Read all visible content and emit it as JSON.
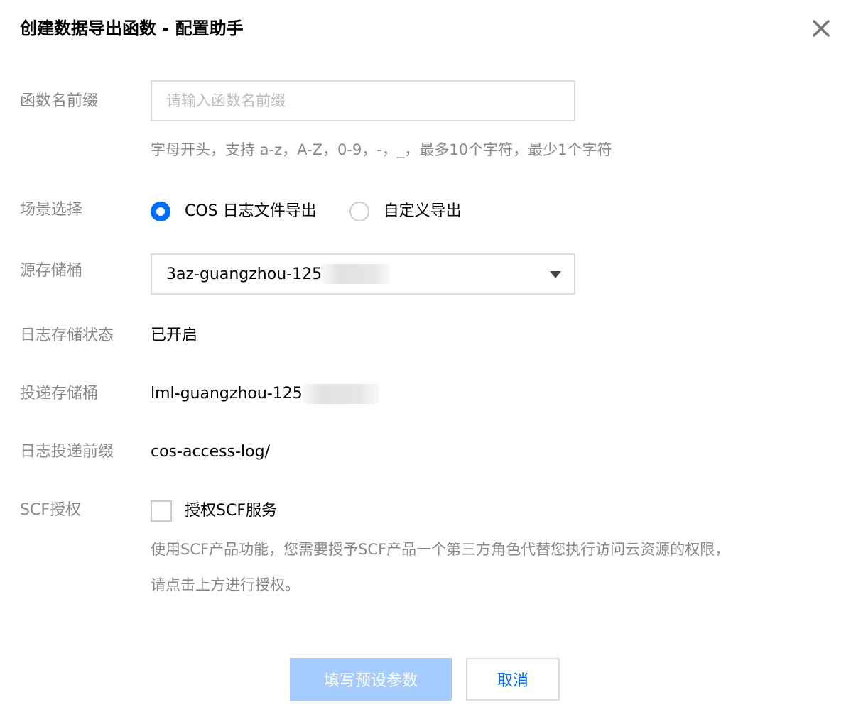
{
  "dialog": {
    "title": "创建数据导出函数 - 配置助手",
    "close_icon": "close-icon"
  },
  "form": {
    "prefix": {
      "label": "函数名前缀",
      "value": "",
      "placeholder": "请输入函数名前缀",
      "hint": "字母开头，支持 a-z，A-Z，0-9，-，_，最多10个字符，最少1个字符"
    },
    "scene": {
      "label": "场景选择",
      "options": [
        {
          "label": "COS 日志文件导出",
          "checked": true
        },
        {
          "label": "自定义导出",
          "checked": false
        }
      ]
    },
    "source_bucket": {
      "label": "源存储桶",
      "selected": "3az-guangzhou-125"
    },
    "log_storage_status": {
      "label": "日志存储状态",
      "value": "已开启"
    },
    "delivery_bucket": {
      "label": "投递存储桶",
      "value": "lml-guangzhou-125"
    },
    "delivery_prefix": {
      "label": "日志投递前缀",
      "value": "cos-access-log/"
    },
    "scf_auth": {
      "label": "SCF授权",
      "checkbox_label": "授权SCF服务",
      "checked": false,
      "hint_line1": "使用SCF产品功能，您需要授予SCF产品一个第三方角色代替您执行访问云资源的权限，",
      "hint_line2": "请点击上方进行授权。"
    }
  },
  "footer": {
    "primary_label": "填写预设参数",
    "cancel_label": "取消"
  },
  "colors": {
    "accent": "#006eff",
    "primary_disabled": "#a6ccff",
    "label": "#888888",
    "border": "#dddddd"
  }
}
